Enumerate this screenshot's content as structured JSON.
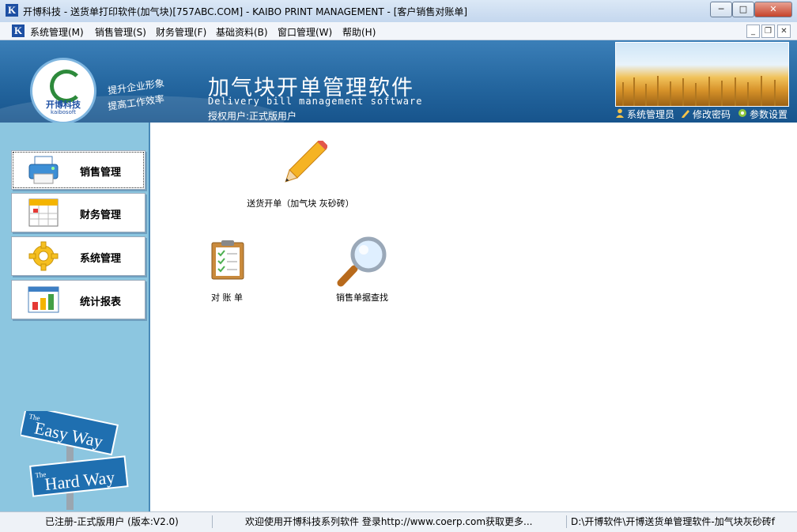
{
  "window": {
    "title": "开博科技 - 送货单打印软件(加气块)[757ABC.COM] - KAIBO PRINT MANAGEMENT - [客户销售对账单]",
    "icon_letter": "K",
    "minimize_glyph": "─",
    "maximize_glyph": "□",
    "close_glyph": "✕"
  },
  "menu": {
    "items": [
      "系统管理(M)",
      "销售管理(S)",
      "财务管理(F)",
      "基础资料(B)",
      "窗口管理(W)",
      "帮助(H)"
    ],
    "mdi_minimize": "_",
    "mdi_restore": "❐",
    "mdi_close": "✕"
  },
  "banner": {
    "logo_name": "开博科技",
    "logo_sub": "kaibosoft",
    "slogan_1": "提升企业形象",
    "slogan_2": "提高工作效率",
    "title": "加气块开单管理软件",
    "subtitle": "Delivery bill management software",
    "auth_user": "授权用户:正式版用户",
    "links": [
      {
        "label": "系统管理员",
        "icon": "user-icon"
      },
      {
        "label": "修改密码",
        "icon": "pencil-icon"
      },
      {
        "label": "参数设置",
        "icon": "settings-icon"
      }
    ]
  },
  "sidebar": {
    "items": [
      {
        "label": "销售管理",
        "icon": "printer-icon"
      },
      {
        "label": "财务管理",
        "icon": "calendar-icon"
      },
      {
        "label": "系统管理",
        "icon": "gear-icon"
      },
      {
        "label": "统计报表",
        "icon": "bar-chart-icon"
      }
    ],
    "sign_top_the": "The",
    "sign_top": "Easy Way",
    "sign_bottom_the": "The",
    "sign_bottom": "Hard Way"
  },
  "main": {
    "functions": [
      {
        "label": "送货开单（加气块 灰砂砖）",
        "icon": "pencil-icon"
      },
      {
        "label": "对 账 单",
        "icon": "clipboard-icon"
      },
      {
        "label": "销售单据查找",
        "icon": "magnifier-icon"
      }
    ]
  },
  "status": {
    "registration": "已注册-正式版用户 (版本:V2.0)",
    "welcome": "欢迎使用开博科技系列软件   登录http://www.coerp.com获取更多...",
    "path": "D:\\开博软件\\开博送货单管理软件-加气块灰砂砖f"
  },
  "colors": {
    "banner_blue": "#24669f",
    "sidebar_blue": "#8cc6e0",
    "accent_gold": "#f1c25a"
  }
}
